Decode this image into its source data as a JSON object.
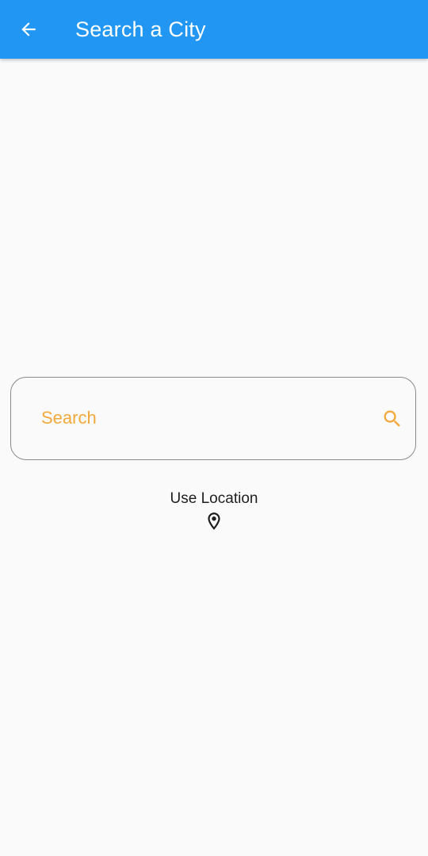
{
  "app_bar": {
    "title": "Search a City",
    "back_icon": "arrow-back-icon",
    "background_color": "#2196f3"
  },
  "search": {
    "placeholder": "Search",
    "value": "",
    "icon": "search-icon",
    "accent_color": "#f2a93b"
  },
  "location": {
    "label": "Use Location",
    "icon": "location-pin-icon"
  }
}
